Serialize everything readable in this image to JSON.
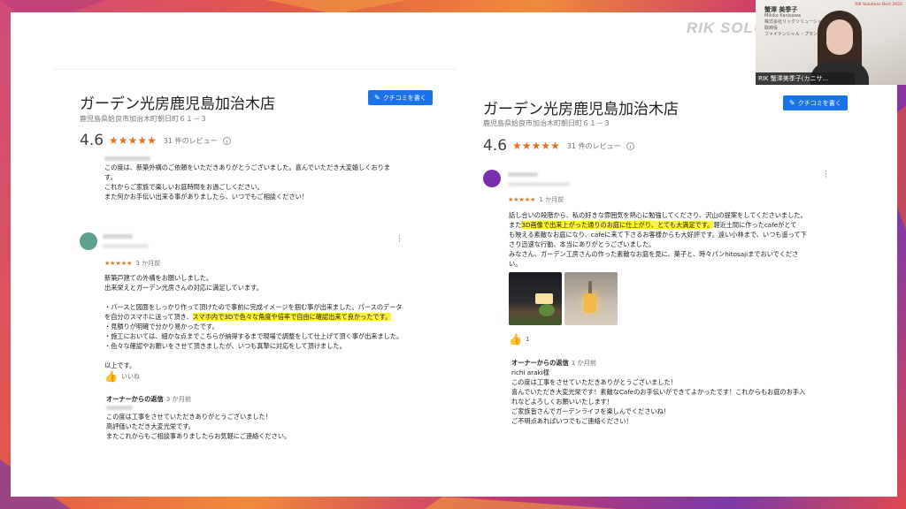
{
  "watermark": "RIK SOLU",
  "left_review": {
    "title": "ガーデン光房鹿児島加治木店",
    "address": "鹿児島県姶良市加治木町朝日町６１－３",
    "rating": "4.6",
    "stars": "★★★★★",
    "review_count": "31 件のレビュー",
    "write_button": "クチコミを書く",
    "owner_reply_top": [
      "この度は、新築外構のご依頼をいただきありがとうございました。喜んでいただき大変嬉しくおりま",
      "す。",
      "これからご家族で楽しいお庭時間をお過ごしください。",
      "また何かお手伝い出来る事がありましたら、いつでもご相談ください！"
    ],
    "review": {
      "stars": "★★★★★",
      "time": "3 か月前",
      "lines_a": [
        "新築戸建ての外構をお願いしました。",
        "出来栄えとガーデン光房さんの対応に満足しています。",
        "",
        "・パースと図面をしっかり作って頂けたので事前に完成イメージを掴む事が出来ました。パースのデータ"
      ],
      "line_b_pre": "を自分のスマホに送って頂き、",
      "line_b_highlight": "スマホ内で3Dで色々な角度や倍率で自由に確認出来て良かったです。",
      "lines_c": [
        "・見積りが明確で分かり易かったです。",
        "・施工においては、細かな点までこちらが納得するまで現場で調整をして仕上げて頂く事が出来ました。",
        "・色々な確認やお願いをさせて頂きましたが、いつも真摯に対応をして頂けました。",
        "",
        "以上です。"
      ],
      "like": "いいね",
      "owner_heading": "オーナーからの返信",
      "owner_time": "3 か月前",
      "owner_lines": [
        "この度は工事をさせていただきありがとうございました！",
        "高評価いただき大変光栄です。",
        "またこれからもご相談事ありましたらお気軽にご連絡ください。"
      ]
    }
  },
  "right_review": {
    "title": "ガーデン光房鹿児島加治木店",
    "address": "鹿児島県姶良市加治木町朝日町６１－３",
    "rating": "4.6",
    "stars": "★★★★★",
    "review_count": "31 件のレビュー",
    "write_button": "クチコミを書く",
    "review": {
      "stars": "★★★★★",
      "time": "1 か月前",
      "line1": "話し合いの段階から、私の好きな雰囲気を熱心に勉強してくださり、沢山の提案をしてくださいました。",
      "line2_pre": "また",
      "line2_highlight": "3D画像で出来上がった通りのお庭に仕上がり、とても大満足です。",
      "line2_post": "軽近土間に作ったcafeがとて",
      "line3": "も映える素敵なお庭になり、cafeに来て下さるお客様からも大好評です。遠い小林まで、いつも遥って下",
      "line4": "さり迅速な行動、本当にありがとうございました。",
      "line5": "みなさん、ガーデン工房さんの作った素敵なお庭を見に、菓子と、時々パンhitosajiまでおいでくださ",
      "line6": "い。",
      "like_count": "1",
      "owner_heading": "オーナーからの返信",
      "owner_time": "1 か月前",
      "owner_lines": [
        "richi araki様",
        "この度は工事をさせていただきありがとうございました！",
        "喜んでいただき大変光栄です！素敵なCafeのお手伝いができてよかったです！これからもお庭のお手入",
        "れなどよろしくお願いいたします！",
        "ご家族皆さんでガーデンライフを楽しんでくださいね！",
        "ご不明点あればいつでもご連絡ください！"
      ]
    }
  },
  "webcam": {
    "card_name": "蟹澤 美季子",
    "card_lines": [
      "Mikiko Kanisawa",
      "株式会社リックソリューション",
      "取締役",
      "ファイナンシャル・プランナー"
    ],
    "logo": "RIK Solutions Best 2022",
    "label": "RIK 蟹澤美季子(カニサ..."
  },
  "colors": {
    "accent": "#1a73e8",
    "star": "#e7711b",
    "highlight": "#fff33a"
  },
  "icons": [
    "pencil-icon",
    "info-icon",
    "thumb-up-icon",
    "more-vert-icon"
  ]
}
